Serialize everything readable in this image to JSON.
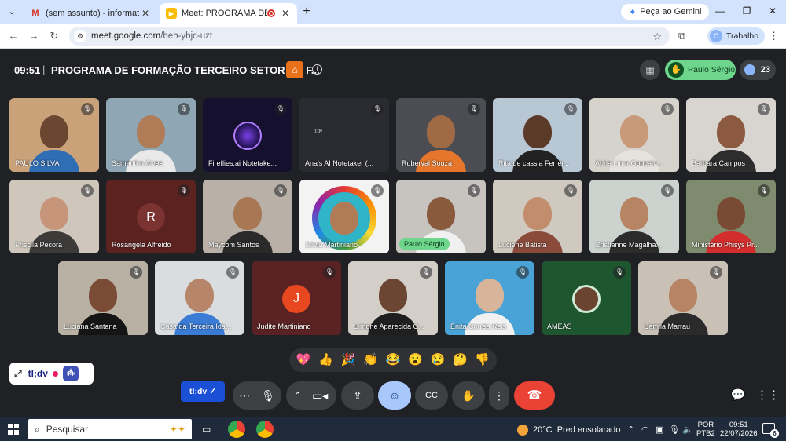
{
  "browser": {
    "tabs": [
      {
        "favicon": "gmail-icon",
        "title": "(sem assunto) - informaticanap",
        "active": false
      },
      {
        "favicon": "meet-icon",
        "title": "Meet: PROGRAMA DE FORM",
        "active": true
      }
    ],
    "gemini_label": "Peça ao Gemini",
    "url_host": "meet.google.com",
    "url_path": "/beh-ybjc-uzt",
    "profile_label": "Trabalho",
    "profile_initial": "C"
  },
  "meet": {
    "time": "09:51",
    "separator": "|",
    "title": "PROGRAMA DE FORMAÇÃO TERCEIRO SETOR EM F...",
    "raised_hand_name": "Paulo Sérgio",
    "participant_count": "23"
  },
  "participants": [
    {
      "name": "PAULO SILVA",
      "bg": "#c9a27a",
      "skin": "#6b4630",
      "shirt": "#2f6db5"
    },
    {
      "name": "Samantha Alves",
      "bg": "#8fa7b4",
      "skin": "#b07c58",
      "shirt": "#e9e9e9"
    },
    {
      "name": "Fireflies.ai Notetake...",
      "bg": "#14102e",
      "type": "bot"
    },
    {
      "name": "Ana's AI Notetaker (...",
      "bg": "#2b2c31",
      "type": "bot2",
      "logo": "tl;dv"
    },
    {
      "name": "Ruberval Souza",
      "bg": "#4b4d52",
      "skin": "#a06a45",
      "shirt": "#e5762b"
    },
    {
      "name": "Rita de cassia Ferrei...",
      "bg": "#b8c7d4",
      "skin": "#5c3a28",
      "shirt": "#222222"
    },
    {
      "name": "Adria Lima Gonçalv...",
      "bg": "#d6d2cc",
      "skin": "#c89a7a",
      "shirt": "#e6e3df"
    },
    {
      "name": "Barbara Campos",
      "bg": "#d8d4cf",
      "skin": "#8b5a40",
      "shirt": "#2d2d2d"
    },
    {
      "name": "Priscila Pecora",
      "bg": "#cfc7bc",
      "skin": "#c7957a",
      "shirt": "#3c3b3a"
    },
    {
      "name": "Rosangela Alfreido",
      "bg": "#5b2220",
      "type": "avatar",
      "initial": "R",
      "avatar_color": "#7a3330"
    },
    {
      "name": "Maycom Santos",
      "bg": "#b9b1a7",
      "skin": "#a87754",
      "shirt": "#2a2a2a"
    },
    {
      "name": "Olivia Martiniano",
      "bg": "#f3f3f3",
      "type": "ring",
      "skin": "#b17b57",
      "shirt": "#6e6e6e"
    },
    {
      "name": "Paulo Sérgio",
      "bg": "#c7c4bf",
      "skin": "#8a5a3c",
      "shirt": "#f0f0f0",
      "speaking": true
    },
    {
      "name": "Luciene Batista",
      "bg": "#cfc9bf",
      "skin": "#c28d6c",
      "shirt": "#8b4b3a"
    },
    {
      "name": "Cristianne Magalha...",
      "bg": "#ccd3cf",
      "skin": "#b88564",
      "shirt": "#2c2c2c"
    },
    {
      "name": "Ministério Phisys Pr...",
      "bg": "#7f8b6e",
      "skin": "#7a4b34",
      "shirt": "#d32d2d"
    },
    {
      "name": "Luciana Santana",
      "bg": "#b8b0a3",
      "skin": "#7a4c36",
      "shirt": "#151515"
    },
    {
      "name": "Casa da Terceira Ida...",
      "bg": "#d9dde0",
      "skin": "#b7866a",
      "shirt": "#3a7bd5"
    },
    {
      "name": "Judite Martiniano",
      "bg": "#5a2222",
      "type": "avatar",
      "initial": "J",
      "avatar_color": "#e8481f"
    },
    {
      "name": "Simone Aparecida C...",
      "bg": "#d3cec7",
      "skin": "#6a4633",
      "shirt": "#1f1f1f"
    },
    {
      "name": "Enita Corrêa Reis",
      "bg": "#4aa3d6",
      "skin": "#d8b49a",
      "shirt": "#f1f1f1"
    },
    {
      "name": "AMEAS",
      "bg": "#1e5630",
      "type": "photo-avatar",
      "skin": "#6b4430"
    },
    {
      "name": "Camila Marrau",
      "bg": "#c9c1b6",
      "skin": "#b78565",
      "shirt": "#2b2b2b"
    }
  ],
  "reactions": [
    "💖",
    "👍",
    "🎉",
    "👏",
    "😂",
    "😮",
    "😢",
    "🤔",
    "👎"
  ],
  "tldv_widget": {
    "logo": "tl;dv"
  },
  "controls": {
    "tldv_button": "tl;dv"
  },
  "taskbar": {
    "search_placeholder": "Pesquisar",
    "temperature": "20°C",
    "weather": "Pred ensolarado",
    "lang_line1": "POR",
    "lang_line2": "PTB2",
    "time": "09:51",
    "date": "22/07/2026",
    "notification_count": "6"
  }
}
